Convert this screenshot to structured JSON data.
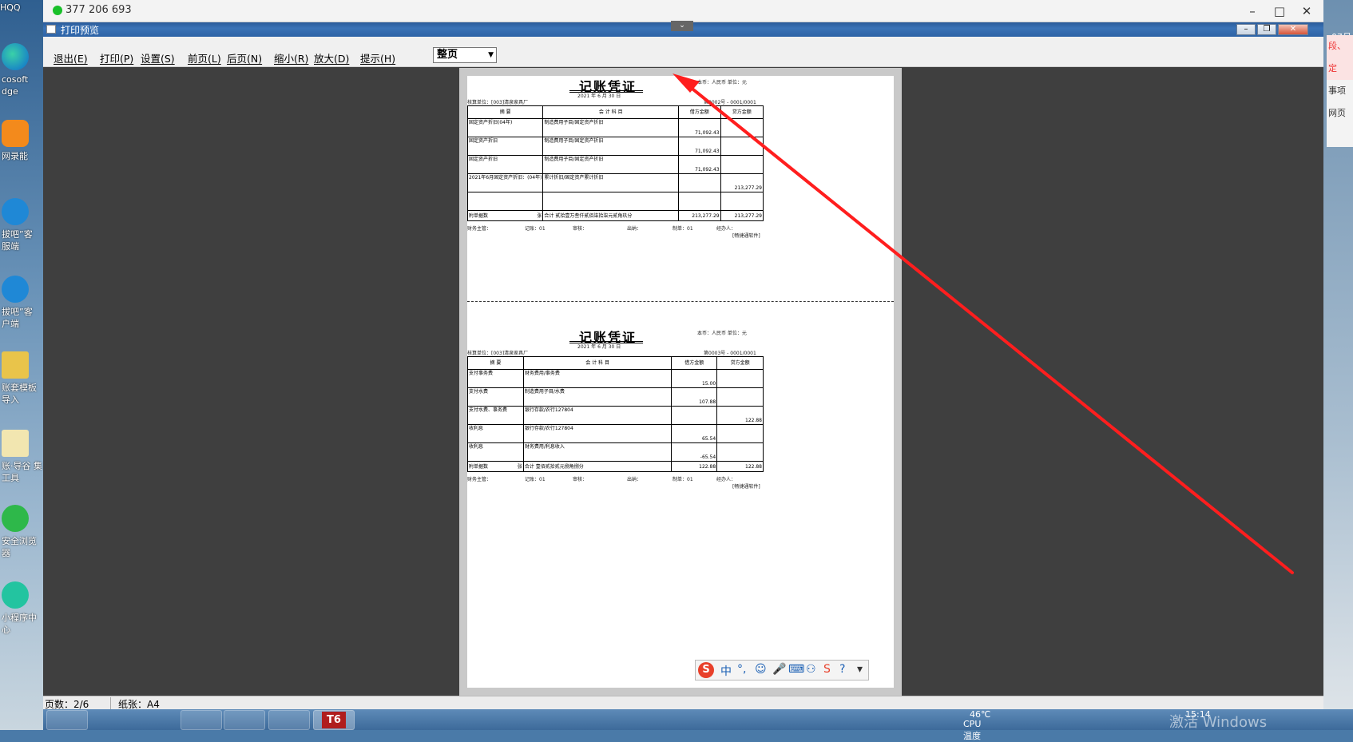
{
  "desktop_left": {
    "icons": [
      {
        "label": "cosoft dge",
        "top_label": "HQQ"
      },
      {
        "label": "网录能"
      },
      {
        "label": "拔吧”客 服端"
      },
      {
        "label": "拔吧”客 户端"
      },
      {
        "label": "账套模板 导入"
      },
      {
        "label": "账·导谷 集工具"
      },
      {
        "label": "安全浏览 器"
      },
      {
        "label": "小程序中 心"
      }
    ]
  },
  "desktop_right": {
    "clock_top": "07月",
    "panel_items": [
      "段、定",
      "事项",
      "网页"
    ],
    "watermark": "激活 Windows"
  },
  "qq_window": {
    "contact": "377 206 693"
  },
  "app": {
    "title": "打印预览",
    "menu": [
      {
        "label": "退出(E)"
      },
      {
        "label": "打印(P)"
      },
      {
        "label": "设置(S)"
      },
      {
        "label": "前页(L)"
      },
      {
        "label": "后页(N)"
      },
      {
        "label": "缩小(R)"
      },
      {
        "label": "放大(D)"
      },
      {
        "label": "提示(H)"
      }
    ],
    "zoom_select": "整页",
    "status": {
      "pages": "页数：2/6",
      "paper": "纸张：A4"
    }
  },
  "vouchers": [
    {
      "title": "记账凭证",
      "currency": "本币：人民币  单位：元",
      "date": "2021 年  6  月 30 日",
      "company": "核算单位：[003]清泉家具厂",
      "number": "第0002号 - 0001/0001",
      "headers": [
        "摘    要",
        "会  计  科  目",
        "借方金额",
        "贷方金额"
      ],
      "rows": [
        {
          "summary": "固定资产折旧(04年)",
          "account": "制造费用子目/固定资产折旧",
          "debit": "71,092.43",
          "credit": ""
        },
        {
          "summary": "固定资产折旧",
          "account": "制造费用子目/固定资产折旧",
          "debit": "71,092.43",
          "credit": ""
        },
        {
          "summary": "固定资产折旧",
          "account": "制造费用子目/固定资产折旧",
          "debit": "71,092.43",
          "credit": ""
        },
        {
          "summary": "2021年6月固定资产折旧：(04年)",
          "account": "累计折旧/固定资产累计折旧",
          "debit": "",
          "credit": "213,277.29"
        },
        {
          "summary": "",
          "account": "",
          "debit": "",
          "credit": ""
        }
      ],
      "footer_left": "附单据数",
      "footer_unit": "张",
      "total_text": "合计  贰拾壹万叁仟贰佰柒拾柒元贰角玖分",
      "total_debit": "213,277.29",
      "total_credit": "213,277.29",
      "signs": [
        "财务主管：",
        "记账：01",
        "审核：",
        "出纳：",
        "制单：01",
        "经办人："
      ],
      "software": "[畅捷通软件]"
    },
    {
      "title": "记账凭证",
      "currency": "本币：人民币  单位：元",
      "date": "2021 年  6  月 30 日",
      "company": "核算单位：[003]清泉家具厂",
      "number": "第0003号 - 0001/0001",
      "headers": [
        "摘    要",
        "会  计  科  目",
        "借方金额",
        "贷方金额"
      ],
      "rows": [
        {
          "summary": "支付事务费",
          "account": "财务费用/事务费",
          "debit": "15.00",
          "credit": ""
        },
        {
          "summary": "支付水费",
          "account": "制造费用子目/水费",
          "debit": "107.88",
          "credit": ""
        },
        {
          "summary": "支付水费、事务费",
          "account": "银行存款/农行127804",
          "debit": "",
          "credit": "122.88"
        },
        {
          "summary": "收利息",
          "account": "银行存款/农行127804",
          "debit": "65.54",
          "credit": ""
        },
        {
          "summary": "收利息",
          "account": "财务费用/利息收入",
          "debit": "-65.54",
          "credit": ""
        }
      ],
      "footer_left": "附单据数",
      "footer_unit": "张",
      "total_text": "合计  壹佰贰拾贰元捌角捌分",
      "total_debit": "122.88",
      "total_credit": "122.88",
      "signs": [
        "财务主管：",
        "记账：01",
        "审核：",
        "出纳：",
        "制单：01",
        "经办人："
      ],
      "software": "[畅捷通软件]"
    }
  ],
  "ime": {
    "chinese": "中"
  },
  "taskbar": {
    "temp": "46℃",
    "cpu": "CPU温度",
    "time": "15:14"
  },
  "colors": {
    "annotation_arrow": "#ff1e1e",
    "title_bar": "#3b73b6",
    "preview_bg": "#3f3f3f"
  }
}
